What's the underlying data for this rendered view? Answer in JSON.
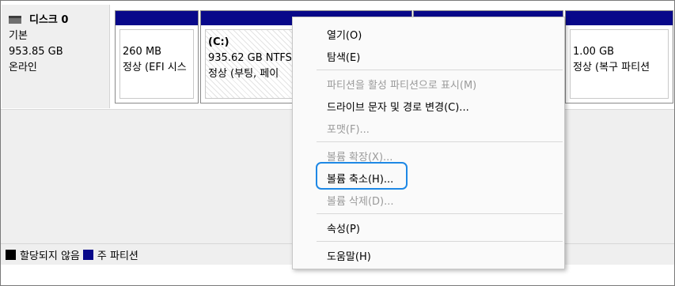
{
  "disk": {
    "name": "디스크 0",
    "type": "기본",
    "size": "953.85 GB",
    "status": "온라인"
  },
  "partitions": [
    {
      "line1": "260 MB",
      "line2": "정상 (EFI 시스"
    },
    {
      "volume": "(C:)",
      "line1": "935.62 GB NTFS",
      "line2": "정상 (부팅, 페이"
    },
    {
      "line1": "1.00 GB",
      "line2": "정상 (복구 파티션"
    }
  ],
  "legend": {
    "unallocated": "할당되지 않음",
    "primary": "주 파티션",
    "unallocated_color": "#000000",
    "primary_color": "#08088a"
  },
  "context_menu": {
    "items": [
      {
        "label": "열기(O)",
        "enabled": true
      },
      {
        "label": "탐색(E)",
        "enabled": true
      },
      {
        "label": "파티션을 활성 파티션으로 표시(M)",
        "enabled": false
      },
      {
        "label": "드라이브 문자 및 경로 변경(C)...",
        "enabled": true
      },
      {
        "label": "포맷(F)...",
        "enabled": false
      },
      {
        "label": "볼륨 확장(X)...",
        "enabled": false
      },
      {
        "label": "볼륨 축소(H)...",
        "enabled": true
      },
      {
        "label": "볼륨 삭제(D)...",
        "enabled": false
      },
      {
        "label": "속성(P)",
        "enabled": true
      },
      {
        "label": "도움말(H)",
        "enabled": true
      }
    ]
  },
  "accent_color": "#1e88e5"
}
